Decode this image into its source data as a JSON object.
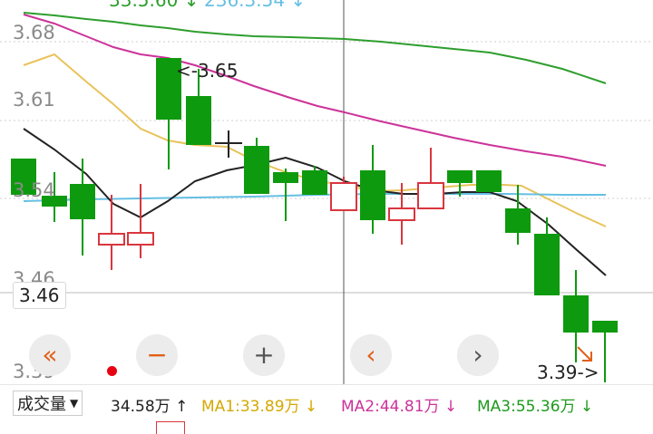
{
  "chart": {
    "ma_header": {
      "ma1": "33.5.60 ↓",
      "ma2": "236.3.54 ↓"
    },
    "y_axis": {
      "labels": [
        "3.68",
        "3.61",
        "3.54",
        "3.46",
        "3.39"
      ],
      "hidden_label": "3.46"
    },
    "last_price": "3.46",
    "annotations": {
      "high": "<-3.65",
      "low": "3.39->"
    },
    "colors": {
      "up": "#d9363e",
      "down": "#0e9a0e",
      "ma_yellow": "#e8c35a",
      "ma_magenta": "#cc3399",
      "ma_green": "#2e9e2e",
      "ma_blue": "#66bfe3",
      "ma_black": "#222222"
    }
  },
  "controls": [
    {
      "name": "fast-backward-icon",
      "glyph": "«",
      "color": "#e0601a"
    },
    {
      "name": "zoom-out-icon",
      "glyph": "−",
      "color": "#e0601a"
    },
    {
      "name": "zoom-in-icon",
      "glyph": "+",
      "color": "#555555"
    },
    {
      "name": "prev-icon",
      "glyph": "‹",
      "color": "#e0601a"
    },
    {
      "name": "next-icon",
      "glyph": "›",
      "color": "#555555"
    },
    {
      "name": "fast-forward-icon",
      "glyph": "»",
      "color": "#e0601a"
    }
  ],
  "volume_bar": {
    "selector_label": "成交量",
    "volume": "34.58万",
    "volume_arrow": "↑",
    "ma1": "MA1:33.89万",
    "ma1_arrow": "↓",
    "ma2": "MA2:44.81万",
    "ma2_arrow": "↓",
    "ma3": "MA3:55.36万",
    "ma3_arrow": "↓",
    "colors": {
      "ma1": "#d4a800",
      "ma2": "#cc3399",
      "ma3": "#1d9a1d"
    }
  }
}
